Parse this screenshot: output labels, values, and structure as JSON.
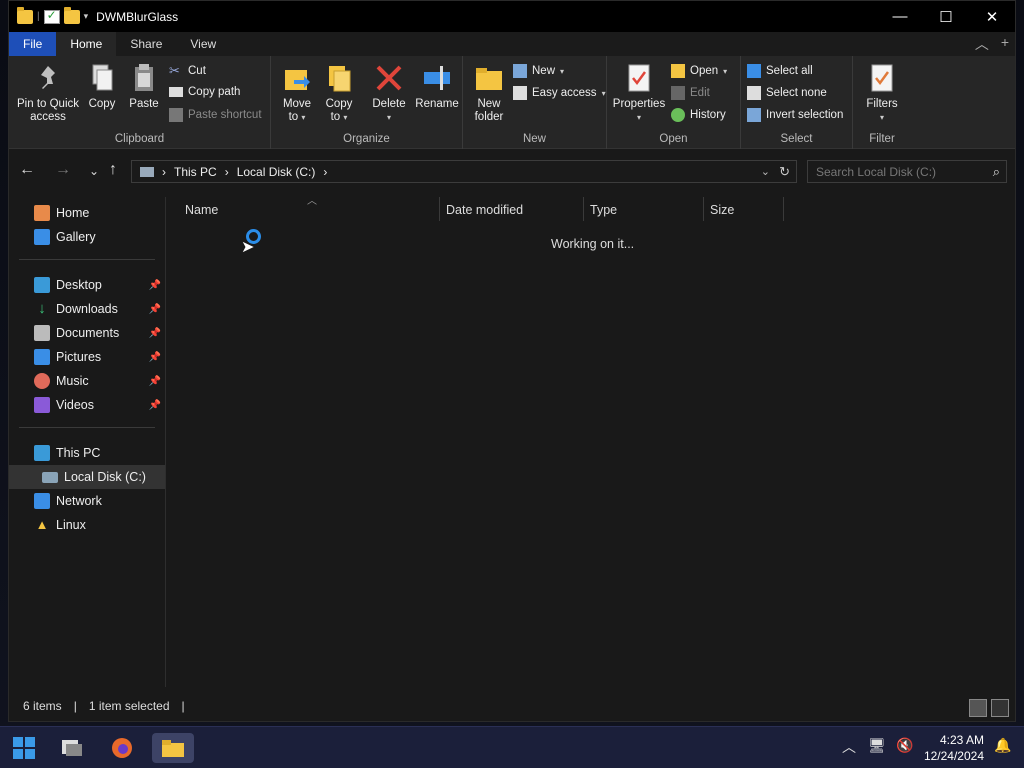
{
  "window": {
    "title": "DWMBlurGlass",
    "minimize": "—",
    "maximize": "☐",
    "close": "✕"
  },
  "tabs": [
    {
      "label": "File"
    },
    {
      "label": "Home"
    },
    {
      "label": "Share"
    },
    {
      "label": "View"
    }
  ],
  "ribbon": {
    "clipboard": {
      "label": "Clipboard",
      "pin": "Pin to Quick access",
      "pin_line1": "Pin to Quick",
      "pin_line2": "access",
      "copy": "Copy",
      "paste": "Paste",
      "cut": "Cut",
      "copy_path": "Copy path",
      "paste_shortcut": "Paste shortcut"
    },
    "organize": {
      "label": "Organize",
      "move_to": "Move",
      "move_to2": "to",
      "copy_to": "Copy",
      "copy_to2": "to",
      "delete": "Delete",
      "rename": "Rename"
    },
    "new": {
      "label": "New",
      "new_folder": "New",
      "new_folder2": "folder",
      "new_item": "New",
      "easy_access": "Easy access"
    },
    "open": {
      "label": "Open",
      "properties": "Properties",
      "open": "Open",
      "edit": "Edit",
      "history": "History"
    },
    "select": {
      "label": "Select",
      "select_all": "Select all",
      "select_none": "Select none",
      "invert": "Invert selection"
    },
    "filter": {
      "label": "Filter",
      "filters": "Filters"
    }
  },
  "address": {
    "crumbs": [
      "This PC",
      "Local Disk (C:)"
    ],
    "search_placeholder": "Search Local Disk (C:)"
  },
  "sidebar": {
    "items": [
      {
        "label": "Home"
      },
      {
        "label": "Gallery"
      },
      {
        "label": "Desktop"
      },
      {
        "label": "Downloads"
      },
      {
        "label": "Documents"
      },
      {
        "label": "Pictures"
      },
      {
        "label": "Music"
      },
      {
        "label": "Videos"
      },
      {
        "label": "This PC"
      },
      {
        "label": "Local Disk (C:)"
      },
      {
        "label": "Network"
      },
      {
        "label": "Linux"
      }
    ]
  },
  "columns": {
    "name": "Name",
    "date": "Date modified",
    "type": "Type",
    "size": "Size"
  },
  "content": {
    "status_message": "Working on it..."
  },
  "statusbar": {
    "items": "6 items",
    "selected": "1 item selected"
  },
  "taskbar": {
    "time": "4:23 AM",
    "date": "12/24/2024"
  },
  "colors": {
    "accent": "#1e4fb8",
    "window_bg": "#191919",
    "ribbon_bg": "#262626",
    "taskbar_bg": "#1b1f3a"
  }
}
